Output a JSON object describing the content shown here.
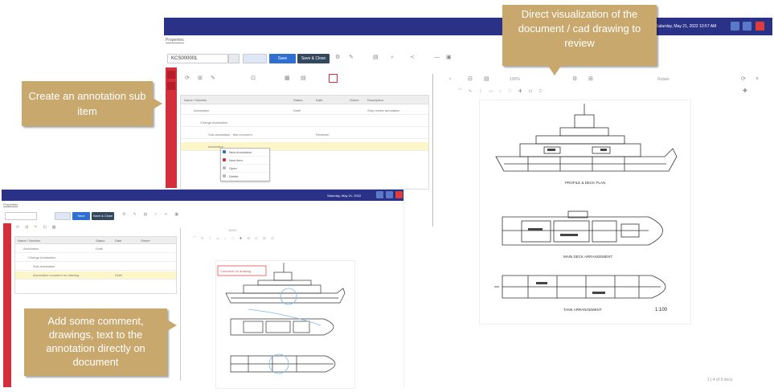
{
  "callouts": {
    "top": "Direct visualization of the document / cad drawing to review",
    "left": "Create an annotation sub item",
    "bottom": "Add some comment, drawings, text to the annotation directly on document"
  },
  "colors": {
    "titlebar": "#2a3288",
    "callout": "#c9a86e",
    "accent_red": "#d32f3a",
    "selection": "#fdf6c8",
    "primary_button": "#2f6fd1"
  },
  "icons": [
    "chevron-down-icon",
    "refresh-icon",
    "settings-icon",
    "share-icon",
    "print-icon",
    "zoom-icon",
    "pen-icon",
    "close-icon",
    "minimize-icon",
    "maximize-icon"
  ],
  "back_window": {
    "tab": "Properties",
    "document_id": "KCS000001",
    "titlebar_text": "Saturday, May 21, 2022 10:57 AM",
    "buttons": {
      "save": "Save",
      "save_close": "Save & Close"
    },
    "table_headers": [
      "Name / Number",
      "Status",
      "Date",
      "Owner",
      "Description"
    ],
    "rows": [
      {
        "name": "Annotation",
        "status": "Draft",
        "date": "",
        "owner": "",
        "description": "Ship review annotation"
      },
      {
        "name": "Change Annotation",
        "status": "",
        "date": "",
        "owner": "",
        "description": ""
      },
      {
        "name": "Sub-annotation - first comment",
        "status": "",
        "date": "",
        "owner": "Reviewer",
        "description": ""
      },
      {
        "name": "Annotation",
        "status": "",
        "date": "",
        "owner": "",
        "description": ""
      }
    ],
    "context_menu": [
      "New Annotation",
      "New Item",
      "Open",
      "Delete"
    ],
    "viewer_zoom": "100%",
    "viewer_label": "Rotate",
    "drawing_captions": [
      "PROFILE & DECK PLAN",
      "MAIN DECK ARRANGEMENT",
      "TANK ARRANGEMENT"
    ],
    "scale_note": "1:100",
    "page_footer": "1 | 4 of 6 docs"
  },
  "front_window": {
    "tab": "Properties",
    "titlebar_text": "Saturday, May 21, 2022",
    "buttons": {
      "save": "Save",
      "save_close": "Save & Close"
    },
    "table_headers": [
      "Name / Number",
      "Status",
      "Date",
      "Owner"
    ],
    "rows": [
      {
        "name": "Annotation",
        "status": "Draft"
      },
      {
        "name": "Change Annotation",
        "status": ""
      },
      {
        "name": "Sub-annotation",
        "status": ""
      },
      {
        "name": "Annotation comment on drawing",
        "status": "Draft"
      }
    ],
    "viewer_zoom": "100%",
    "redline_note": "Comment on drawing"
  }
}
